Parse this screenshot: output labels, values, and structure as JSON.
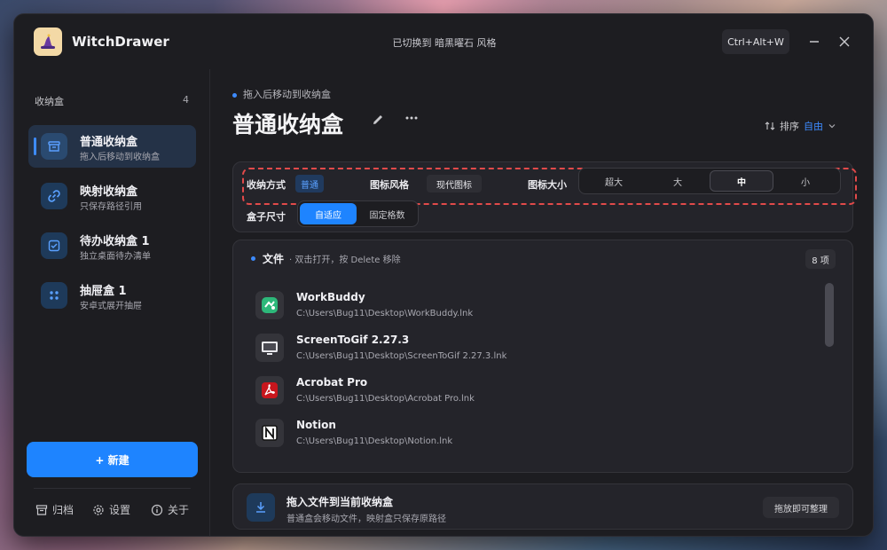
{
  "app": {
    "title": "WitchDrawer",
    "status": "已切换到 暗黑曜石 风格",
    "hotkey": "Ctrl+Alt+W"
  },
  "sidebar": {
    "heading": "收纳盒",
    "count": "4",
    "items": [
      {
        "title": "普通收纳盒",
        "subtitle": "拖入后移动到收纳盒",
        "icon": "archive-box-icon",
        "active": true
      },
      {
        "title": "映射收纳盒",
        "subtitle": "只保存路径引用",
        "icon": "link-icon",
        "active": false
      },
      {
        "title": "待办收纳盒 1",
        "subtitle": "独立桌面待办清单",
        "icon": "checkbox-icon",
        "active": false
      },
      {
        "title": "抽屉盒 1",
        "subtitle": "安卓式展开抽屉",
        "icon": "grid-dots-icon",
        "active": false
      }
    ],
    "new_button": "+ 新建",
    "footer": {
      "archive": "归档",
      "settings": "设置",
      "about": "关于"
    }
  },
  "main": {
    "breadcrumb": "拖入后移动到收纳盒",
    "title": "普通收纳盒",
    "sort_label": "排序",
    "sort_value": "自由",
    "settings": {
      "storage_mode_label": "收纳方式",
      "storage_mode_value": "普通",
      "icon_style_label": "图标风格",
      "icon_style_value": "现代图标",
      "icon_size_label": "图标大小",
      "icon_size_options": [
        "超大",
        "大",
        "中",
        "小"
      ],
      "icon_size_selected": "中",
      "box_size_label": "盒子尺寸",
      "box_size_options": [
        "自适应",
        "固定格数"
      ],
      "box_size_selected": "自适应"
    },
    "files": {
      "heading": "文件",
      "hint": "· 双击打开，按 Delete 移除",
      "count": "8 项",
      "items": [
        {
          "name": "WorkBuddy",
          "path": "C:\\Users\\Bug11\\Desktop\\WorkBuddy.lnk",
          "icon": "workbuddy-icon"
        },
        {
          "name": "ScreenToGif 2.27.3",
          "path": "C:\\Users\\Bug11\\Desktop\\ScreenToGif 2.27.3.lnk",
          "icon": "screentogif-icon"
        },
        {
          "name": "Acrobat Pro",
          "path": "C:\\Users\\Bug11\\Desktop\\Acrobat Pro.lnk",
          "icon": "acrobat-icon"
        },
        {
          "name": "Notion",
          "path": "C:\\Users\\Bug11\\Desktop\\Notion.lnk",
          "icon": "notion-icon"
        }
      ]
    },
    "drop": {
      "title": "拖入文件到当前收纳盒",
      "subtitle": "普通盒会移动文件，映射盒只保存原路径",
      "badge": "拖放即可整理"
    }
  },
  "colors": {
    "accent": "#1e84ff",
    "window_bg": "#1d1d21",
    "panel_bg": "#24242a",
    "dashed_highlight": "#e24a4a"
  }
}
